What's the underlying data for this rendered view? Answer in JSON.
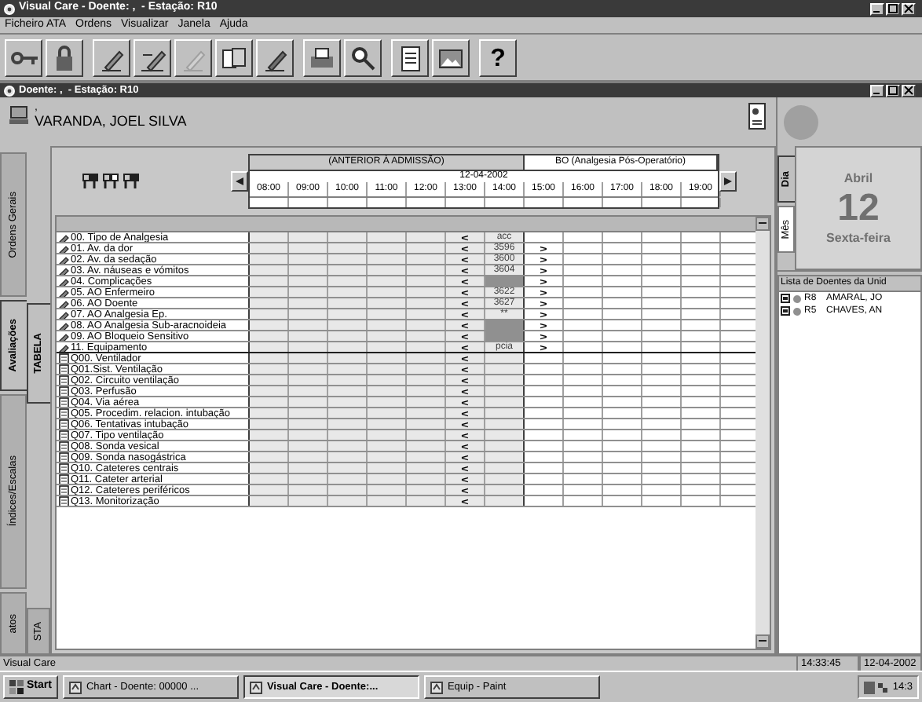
{
  "window": {
    "title": "Visual Care - Doente: ,  - Estação: R10"
  },
  "menu": [
    "Ficheiro ATA",
    "Ordens",
    "Visualizar",
    "Janela",
    "Ajuda"
  ],
  "toolbar": {
    "help_button": "?"
  },
  "inner_window": {
    "title": "Doente: ,  - Estação: R10"
  },
  "patient": {
    "line_1": ",",
    "name": "VARANDA, JOEL SILVA"
  },
  "side_tabs": [
    {
      "label": "Ordens Gerais",
      "selected": false
    },
    {
      "label": "Avaliações",
      "selected": true
    },
    {
      "label": "Índices/Escalas",
      "selected": false
    },
    {
      "label": "atos",
      "selected": false
    }
  ],
  "view_tabs": [
    {
      "label": "TABELA",
      "selected": true
    },
    {
      "label": "STA",
      "selected": false
    }
  ],
  "grid": {
    "bands": [
      "(ANTERIOR À ADMISSÃO)",
      "BO (Analgesia Pós-Operatório)"
    ],
    "date": "12-04-2002",
    "times": [
      "08:00",
      "09:00",
      "10:00",
      "11:00",
      "12:00",
      "13:00",
      "14:00",
      "15:00",
      "16:00",
      "17:00",
      "18:00",
      "19:00"
    ],
    "rows": [
      {
        "kind": "analgesia",
        "label": "00. Tipo de Analgesia",
        "start_marker": "<",
        "value": "acc",
        "shaded": false
      },
      {
        "kind": "analgesia",
        "label": "01. Av. da dor",
        "start_marker": "<",
        "value": "3596",
        "shaded": false,
        "end_marker": ">"
      },
      {
        "kind": "analgesia",
        "label": "02. Av. da sedação",
        "start_marker": "<",
        "value": "3600",
        "shaded": false,
        "end_marker": ">"
      },
      {
        "kind": "analgesia",
        "label": "03. Av. náuseas e vómitos",
        "start_marker": "<",
        "value": "3604",
        "shaded": false,
        "end_marker": ">"
      },
      {
        "kind": "analgesia",
        "label": "04. Complicações",
        "start_marker": "<",
        "shaded": true,
        "end_marker": ">"
      },
      {
        "kind": "analgesia",
        "label": "05. AO Enfermeiro",
        "start_marker": "<",
        "value": "3622",
        "shaded": false,
        "end_marker": ">"
      },
      {
        "kind": "analgesia",
        "label": "06. AO Doente",
        "start_marker": "<",
        "value": "3627",
        "shaded": false,
        "end_marker": ">"
      },
      {
        "kind": "analgesia",
        "label": "07. AO Analgesia Ep.",
        "start_marker": "<",
        "value": "**",
        "shaded": false,
        "end_marker": ">"
      },
      {
        "kind": "analgesia",
        "label": "08. AO Analgesia Sub-aracnoideia",
        "start_marker": "<",
        "shaded": true,
        "end_marker": ">"
      },
      {
        "kind": "analgesia",
        "label": "09. AO Bloqueio Sensitivo",
        "start_marker": "<",
        "shaded": true,
        "end_marker": ">"
      },
      {
        "kind": "analgesia",
        "label": "11. Equipamento",
        "start_marker": "<",
        "value": "pcia",
        "shaded": false,
        "end_marker": ">"
      },
      {
        "kind": "order",
        "label": "Q00. Ventilador",
        "start_marker": "<",
        "shaded": false
      },
      {
        "kind": "order",
        "label": "Q01.Sist. Ventilação",
        "start_marker": "<",
        "shaded": false
      },
      {
        "kind": "order",
        "label": "Q02. Circuito ventilação",
        "start_marker": "<",
        "shaded": false
      },
      {
        "kind": "order",
        "label": "Q03. Perfusão",
        "start_marker": "<",
        "shaded": false
      },
      {
        "kind": "order",
        "label": "Q04. Via aérea",
        "start_marker": "<",
        "shaded": false
      },
      {
        "kind": "order",
        "label": "Q05. Procedim. relacion. intubação",
        "start_marker": "<",
        "shaded": false
      },
      {
        "kind": "order",
        "label": "Q06. Tentativas intubação",
        "start_marker": "<",
        "shaded": false
      },
      {
        "kind": "order",
        "label": "Q07. Tipo ventilação",
        "start_marker": "<",
        "shaded": false
      },
      {
        "kind": "order",
        "label": "Q08. Sonda vesical",
        "start_marker": "<",
        "shaded": false
      },
      {
        "kind": "order",
        "label": "Q09. Sonda nasogástrica",
        "start_marker": "<",
        "shaded": false
      },
      {
        "kind": "order",
        "label": "Q10. Cateteres centrais",
        "start_marker": "<",
        "shaded": false
      },
      {
        "kind": "order",
        "label": "Q11. Cateter arterial",
        "start_marker": "<",
        "shaded": false
      },
      {
        "kind": "order",
        "label": "Q12. Cateteres periféricos",
        "start_marker": "<",
        "shaded": false
      },
      {
        "kind": "order",
        "label": "Q13. Monitorização",
        "start_marker": "<",
        "shaded": false
      }
    ]
  },
  "calendar": {
    "month": "Abril",
    "day": "12",
    "weekday": "Sexta-feira",
    "tabs": [
      {
        "label": "Dia",
        "selected": true
      },
      {
        "label": "Mês",
        "selected": false
      }
    ]
  },
  "patient_list": {
    "title": "Lista de Doentes da Unid",
    "items": [
      {
        "bed": "R8",
        "name": "AMARAL, JO"
      },
      {
        "bed": "R5",
        "name": "CHAVES, AN"
      }
    ]
  },
  "status_bar": {
    "text": "Visual Care",
    "time": "14:33:45",
    "date": "12-04-2002"
  },
  "taskbar": {
    "start": "Start",
    "items": [
      {
        "label": "Chart - Doente: 00000 ...",
        "selected": false
      },
      {
        "label": "Visual Care - Doente:...",
        "selected": true
      },
      {
        "label": "Equip - Paint",
        "selected": false
      }
    ],
    "clock": "14:3"
  }
}
